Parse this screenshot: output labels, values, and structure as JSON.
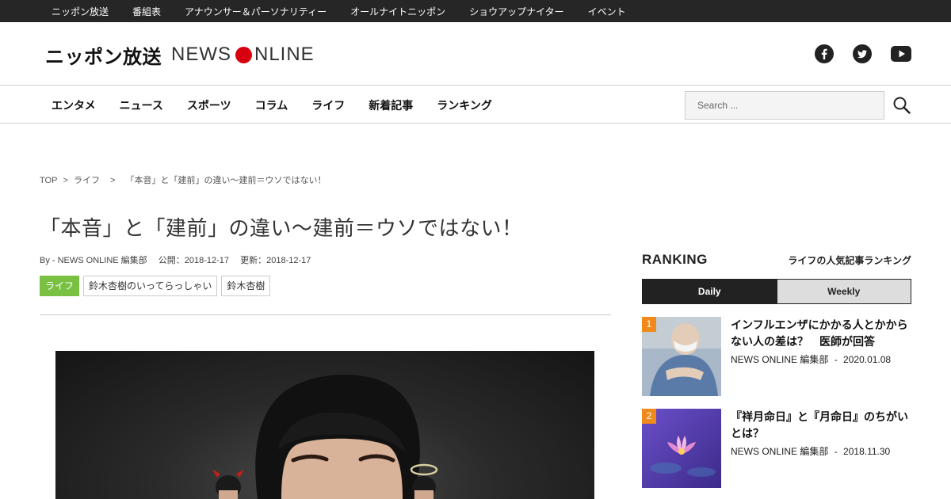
{
  "topbar": {
    "links": [
      "ニッポン放送",
      "番組表",
      "アナウンサー＆パーソナリティー",
      "オールナイトニッポン",
      "ショウアップナイター",
      "イベント"
    ]
  },
  "header": {
    "logo_jp": "ニッポン放送",
    "logo_en_1": "NEWS",
    "logo_en_2": "NLINE",
    "social_icons": [
      "facebook-icon",
      "twitter-icon",
      "youtube-icon"
    ]
  },
  "nav": {
    "items": [
      "エンタメ",
      "ニュース",
      "スポーツ",
      "コラム",
      "ライフ",
      "新着記事",
      "ランキング"
    ],
    "search_placeholder": "Search ..."
  },
  "breadcrumb": {
    "top": "TOP",
    "sep1": ">",
    "category": "ライフ",
    "sep2": ">",
    "current": "「本音」と「建前」の違い～建前＝ウソではない！"
  },
  "article": {
    "title": "「本音」と「建前」の違い～建前＝ウソではない！",
    "author": "By - NEWS ONLINE 編集部",
    "published": "公開：2018-12-17",
    "updated": "更新：2018-12-17",
    "tags": [
      "ライフ",
      "鈴木杏樹のいってらっしゃい",
      "鈴木杏樹"
    ]
  },
  "sidebar": {
    "ranking_title": "RANKING",
    "ranking_subtitle": "ライフの人気記事ランキング",
    "tabs": [
      "Daily",
      "Weekly"
    ],
    "active_tab": "Daily",
    "items": [
      {
        "rank": "1",
        "title": "インフルエンザにかかる人とかからない人の差は？　医師が回答",
        "author": "NEWS ONLINE 編集部",
        "date": "2020.01.08"
      },
      {
        "rank": "2",
        "title": "『祥月命日』と『月命日』のちがいとは？",
        "author": "NEWS ONLINE 編集部",
        "date": "2018.11.30"
      }
    ],
    "sep": "-"
  },
  "colors": {
    "topbar_bg": "#262626",
    "brand_red": "#d7000f",
    "category_green": "#7ac143",
    "rank_orange": "#f08a1c"
  }
}
